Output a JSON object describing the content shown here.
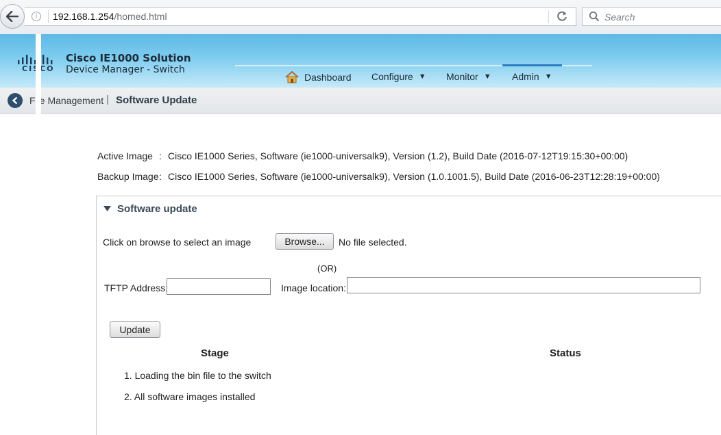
{
  "browser": {
    "url_host": "192.168.1.254",
    "url_path": "/homed.html",
    "search_placeholder": "Search"
  },
  "header": {
    "logo_text": "CISCO",
    "app_title": "Cisco IE1000 Solution",
    "app_subtitle": "Device Manager - Switch",
    "nav": {
      "dashboard": "Dashboard",
      "configure": "Configure",
      "monitor": "Monitor",
      "admin": "Admin",
      "active": "Admin"
    }
  },
  "breadcrumb": {
    "parent": "File Management",
    "separator": "|",
    "current": "Software Update"
  },
  "images": {
    "active_label": "Active Image",
    "active_value": "Cisco IE1000 Series, Software (ie1000-universalk9), Version (1.2), Build Date (2016-07-12T19:15:30+00:00)",
    "backup_label": "Backup Image",
    "backup_value": "Cisco IE1000 Series, Software (ie1000-universalk9), Version (1.0.1001.5), Build Date (2016-06-23T12:28:19+00:00)",
    "colon": ":"
  },
  "software_update": {
    "section_title": "Software update",
    "browse_prompt": "Click on browse to select an image",
    "browse_button": "Browse...",
    "file_status": "No file selected.",
    "or_text": "(OR)",
    "tftp_label": "TFTP Address:",
    "tftp_value": "",
    "image_location_label": "Image location:",
    "image_location_value": "",
    "update_button": "Update",
    "table": {
      "stage_header": "Stage",
      "status_header": "Status",
      "rows": [
        {
          "stage": "1. Loading the bin file to the switch",
          "status": ""
        },
        {
          "stage": "2. All software images installed",
          "status": ""
        }
      ]
    }
  },
  "colors": {
    "header_gradient_top": "#5cb9e6",
    "header_gradient_bottom": "#c5e9f8",
    "active_nav_underline": "#2a7fc0",
    "crumb_back": "#2d4e6e"
  },
  "icons": [
    "back-arrow-icon",
    "info-icon",
    "reload-icon",
    "search-icon",
    "cisco-logo",
    "home-icon",
    "chevron-down-icon",
    "back-circle-icon",
    "triangle-down-icon"
  ]
}
